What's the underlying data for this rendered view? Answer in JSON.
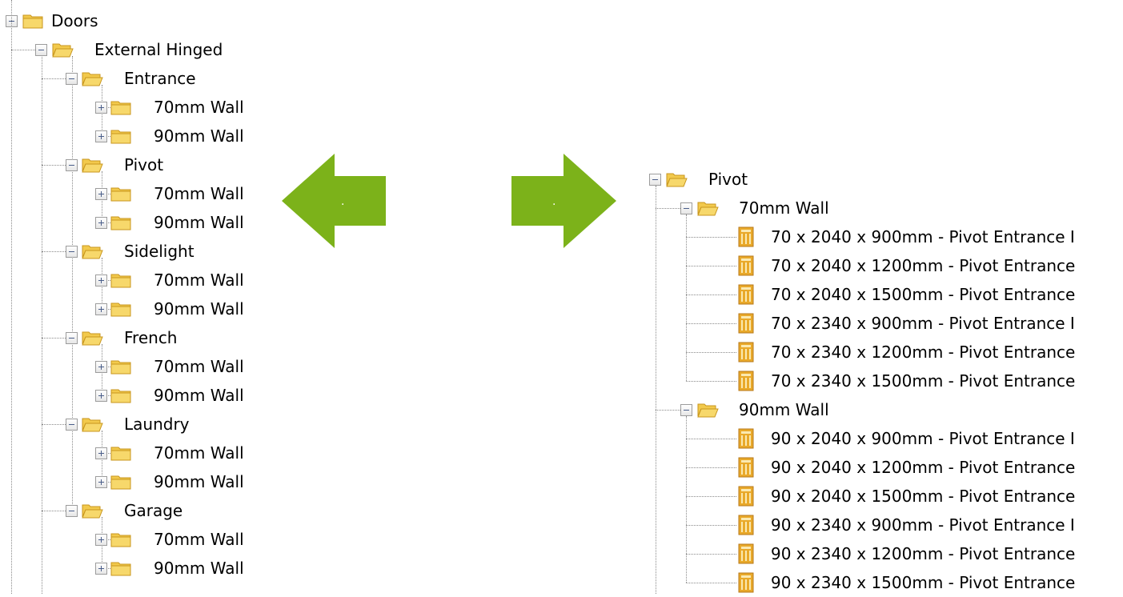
{
  "left_tree": {
    "root_label": "Doors",
    "category_label": "External Hinged",
    "groups": [
      {
        "label": "Entrance",
        "children": [
          "70mm Wall",
          "90mm Wall"
        ]
      },
      {
        "label": "Pivot",
        "children": [
          "70mm Wall",
          "90mm Wall"
        ]
      },
      {
        "label": "Sidelight",
        "children": [
          "70mm Wall",
          "90mm Wall"
        ]
      },
      {
        "label": "French",
        "children": [
          "70mm Wall",
          "90mm Wall"
        ]
      },
      {
        "label": "Laundry",
        "children": [
          "70mm Wall",
          "90mm Wall"
        ]
      },
      {
        "label": "Garage",
        "children": [
          "70mm Wall",
          "90mm Wall"
        ]
      }
    ]
  },
  "right_tree": {
    "root_label": "Pivot",
    "groups": [
      {
        "label": "70mm Wall",
        "items": [
          "70 x 2040 x 900mm - Pivot Entrance  I",
          "70 x 2040 x 1200mm - Pivot Entrance",
          "70 x 2040 x 1500mm - Pivot Entrance",
          "70 x 2340 x 900mm - Pivot Entrance  I",
          "70 x 2340 x 1200mm - Pivot Entrance",
          "70 x 2340 x 1500mm - Pivot Entrance"
        ]
      },
      {
        "label": "90mm Wall",
        "items": [
          "90 x 2040 x 900mm - Pivot Entrance  I",
          "90 x 2040 x 1200mm - Pivot Entrance",
          "90 x 2040 x 1500mm - Pivot Entrance",
          "90 x 2340 x 900mm - Pivot Entrance  I",
          "90 x 2340 x 1200mm - Pivot Entrance",
          "90 x 2340 x 1500mm - Pivot Entrance"
        ]
      }
    ]
  },
  "arrows": {
    "left_label": ".",
    "right_label": ".",
    "color": "#7cb21a"
  },
  "icons": {
    "folder_closed": "folder-icon",
    "folder_open": "folder-open-icon",
    "door": "door-icon",
    "collapse": "collapse-icon",
    "expand": "expand-icon"
  },
  "colors": {
    "folder_fill": "#f2c94c",
    "folder_stroke": "#c8961e",
    "door_fill": "#e9a92a",
    "tree_line": "#8a8a8a"
  }
}
